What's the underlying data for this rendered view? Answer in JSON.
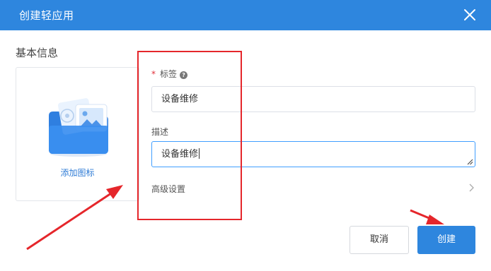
{
  "dialog": {
    "title": "创建轻应用",
    "close_icon": "close-icon"
  },
  "basic_info": {
    "section_title": "基本信息",
    "add_icon_label": "添加图标",
    "icon_placeholder": "folder-image-icon"
  },
  "form": {
    "tag": {
      "required_mark": "*",
      "label": "标签",
      "help_icon": "help-icon",
      "help_glyph": "?",
      "value": "设备维修"
    },
    "description": {
      "label": "描述",
      "value": "设备维修"
    },
    "advanced": {
      "label": "高级设置",
      "chevron_icon": "chevron-right-icon"
    }
  },
  "footer": {
    "cancel_label": "取消",
    "create_label": "创建"
  },
  "colors": {
    "primary": "#2e86de",
    "annotation_red": "#e5262b",
    "link_blue": "#2e7bd6"
  }
}
